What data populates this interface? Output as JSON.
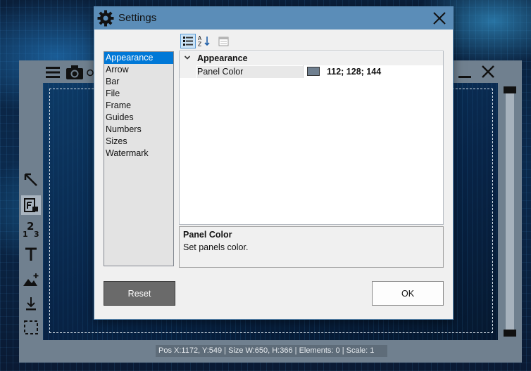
{
  "dialog": {
    "title": "Settings",
    "categories": [
      "Appearance",
      "Arrow",
      "Bar",
      "File",
      "Frame",
      "Guides",
      "Numbers",
      "Sizes",
      "Watermark"
    ],
    "selected_category": "Appearance",
    "grid": {
      "category_label": "Appearance",
      "property_name": "Panel Color",
      "property_value": "112; 128; 144",
      "swatch_color": "#708090"
    },
    "help": {
      "title": "Panel Color",
      "description": "Set panels color."
    },
    "reset_label": "Reset",
    "ok_label": "OK",
    "accent_color": "#5b8db8"
  },
  "app": {
    "status": "Pos X:1172, Y:549 | Size W:650, H:366 | Elements: 0 | Scale: 1",
    "panel_color": "#708090"
  }
}
